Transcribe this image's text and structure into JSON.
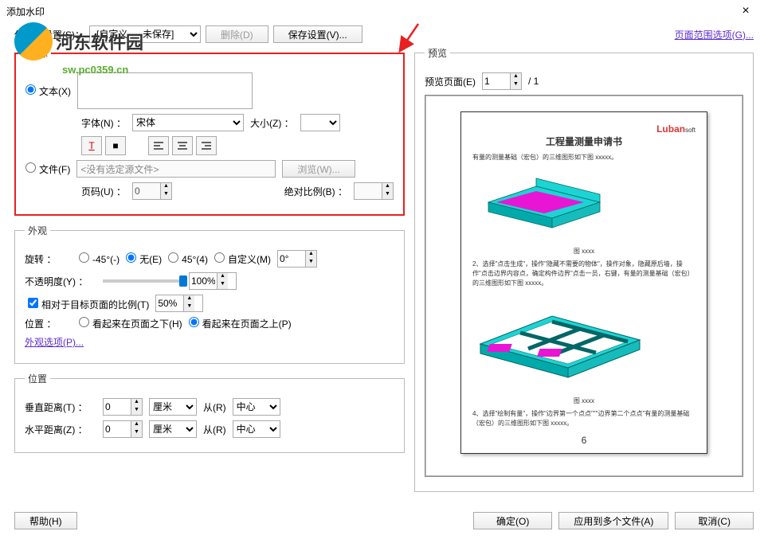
{
  "window": {
    "title": "添加水印",
    "close": "×"
  },
  "toolbar": {
    "saved_label": "保存的设置(S)：",
    "saved_value": "[自定义 — 未保存]",
    "delete": "删除(D)",
    "save": "保存设置(V)...",
    "page_range": "页面范围选项(G)..."
  },
  "logo": {
    "main": "河东软件园",
    "sub": "sw.pc0359.cn"
  },
  "source": {
    "legend": "来源",
    "text_radio": "文本(X)",
    "font_label": "字体(N) ：",
    "font_value": "宋体",
    "size_label": "大小(Z) ：",
    "underline": "T",
    "color": "■",
    "file_radio": "文件(F)",
    "file_value": "<没有选定源文件>",
    "browse": "浏览(W)...",
    "page_label": "页码(U) ：",
    "page_value": "0",
    "scale_label": "绝对比例(B) ："
  },
  "appearance": {
    "legend": "外观",
    "rotate_label": "旋转 ：",
    "rot_neg45": "-45°(-)",
    "rot_none": "无(E)",
    "rot_45": "45°(4)",
    "rot_custom": "自定义(M)",
    "rot_custom_val": "0°",
    "opacity_label": "不透明度(Y) ：",
    "opacity_val": "100%",
    "relative_scale": "相对于目标页面的比例(T)",
    "relative_val": "50%",
    "position_label": "位置 ：",
    "pos_below": "看起来在页面之下(H)",
    "pos_above": "看起来在页面之上(P)",
    "options": "外观选项(P)..."
  },
  "location": {
    "legend": "位置",
    "vdist": "垂直距离(T) ：",
    "hdist": "水平距离(Z) ：",
    "val": "0",
    "unit": "厘米",
    "from": "从(R)",
    "center": "中心"
  },
  "preview": {
    "legend": "预览",
    "page_label": "预览页面(E)",
    "page_val": "1",
    "total": "/ 1",
    "doc_title": "工程量测量申请书",
    "brand": "Lubansoft",
    "line1": "有量的测量基础（宏包）的三维图形如下图 xxxxx。",
    "caption1": "图 xxxx",
    "line2": "2、选择\"点击生成\"，操作\"隐藏不需要的物体\"，操作对象，隐藏原后墙，操作\"点击边界内容点，确定构件边界\"点击一员，右键，有量的测量基础（宏包）的三维图形如下图 xxxxx。",
    "caption2": "图 xxxx",
    "line3": "4、选择\"绘制有量\"，操作\"边界第一个点点\"\"\"边界第二个点点\"有量的测量基础（宏包）的三维图形如下图 xxxxx。",
    "pagenum": "6"
  },
  "footer": {
    "help": "帮助(H)",
    "ok": "确定(O)",
    "apply_multi": "应用到多个文件(A)",
    "cancel": "取消(C)"
  }
}
